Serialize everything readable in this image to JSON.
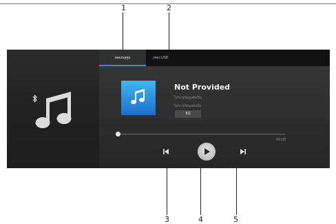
{
  "callouts": [
    "1",
    "2",
    "3",
    "4",
    "5"
  ],
  "tabs": [
    {
      "label": "เพลงบลูทูธ",
      "active": true
    },
    {
      "label": "เพลง USB",
      "active": false
    }
  ],
  "left_panel": {
    "icons": [
      "bluetooth-icon",
      "music-note-icon"
    ]
  },
  "track": {
    "title": "Not Provided",
    "line1": "ไม่ระบุข้อมูลศิลปิน",
    "line2": "ไม่ระบุข้อมูลอัลบั้ม",
    "album_art_icon": "music-note-icon"
  },
  "eq_label": "EQ",
  "playback": {
    "progress": 0,
    "time": "00:00"
  },
  "controls": [
    "previous-icon",
    "play-icon",
    "next-icon"
  ],
  "colors": {
    "accent": "#2f8fd6",
    "album_top": "#3fb6f2",
    "album_bottom": "#1e6fcb"
  }
}
